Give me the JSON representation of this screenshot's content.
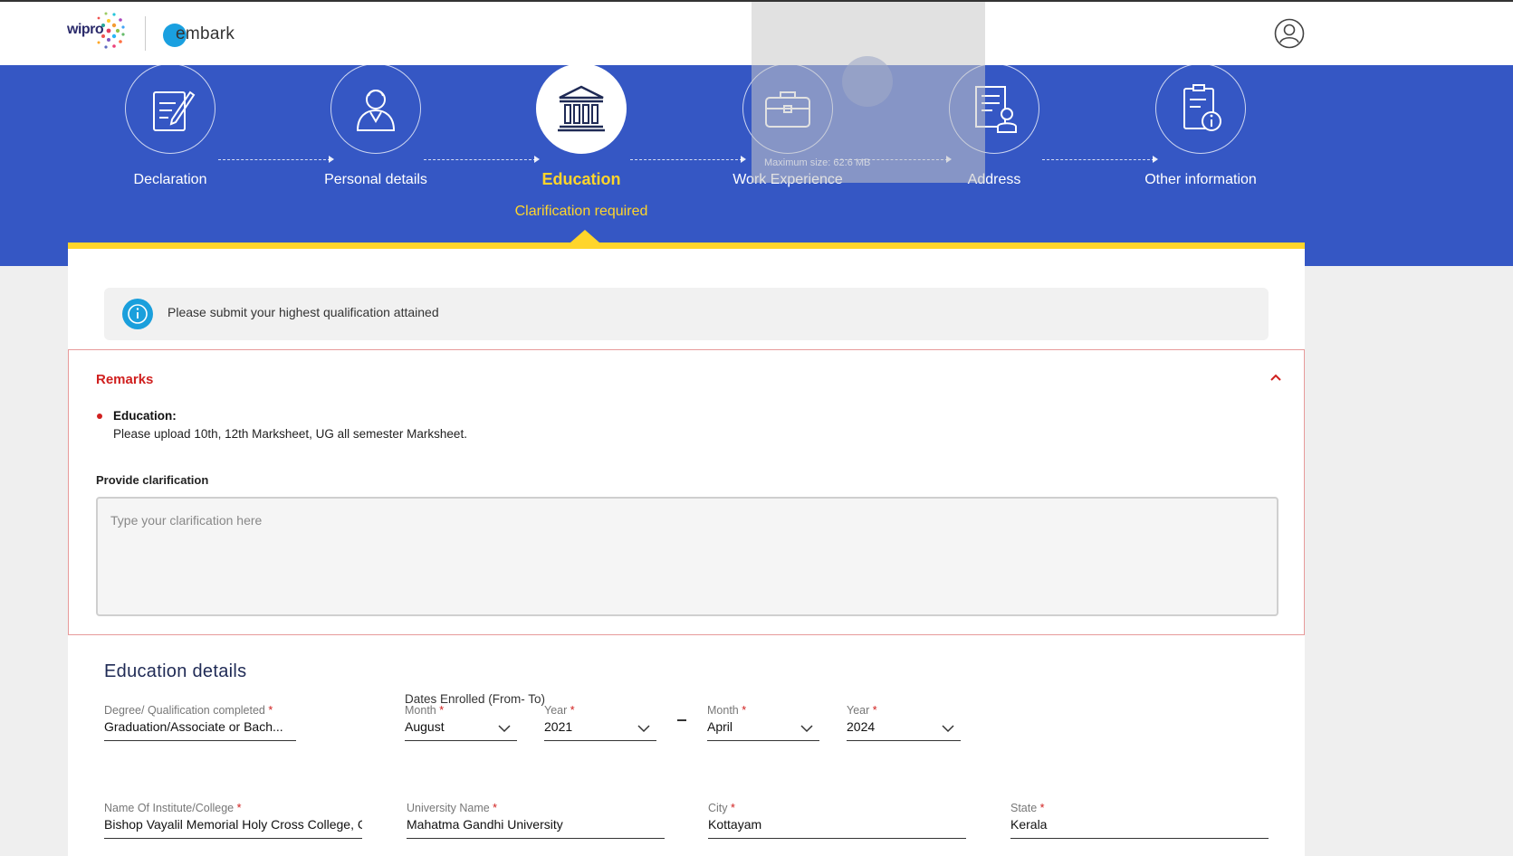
{
  "header": {
    "logo_primary": "wipro",
    "logo_secondary": "embark",
    "profile_icon": "user-circle-icon"
  },
  "overlay": {
    "text": "Maximum size: 62.6 MB"
  },
  "steps": [
    {
      "label": "Declaration",
      "icon": "document-edit-icon",
      "active": false
    },
    {
      "label": "Personal details",
      "icon": "person-icon",
      "active": false
    },
    {
      "label": "Education",
      "icon": "institution-icon",
      "active": true,
      "status": "Clarification required"
    },
    {
      "label": "Work Experience",
      "icon": "briefcase-icon",
      "active": false
    },
    {
      "label": "Address",
      "icon": "address-document-icon",
      "active": false
    },
    {
      "label": "Other information",
      "icon": "info-document-icon",
      "active": false
    }
  ],
  "info": {
    "text": "Please submit your highest qualification attained"
  },
  "remarks": {
    "title": "Remarks",
    "item_label": "Education:",
    "item_text": "Please upload 10th, 12th Marksheet, UG all semester Marksheet.",
    "clarification_label": "Provide clarification",
    "clarification_placeholder": "Type your clarification here",
    "clarification_value": ""
  },
  "education": {
    "section_title": "Education details",
    "dates_title": "Dates Enrolled (From- To)",
    "degree": {
      "label": "Degree/ Qualification completed",
      "value": "Graduation/Associate or Bach..."
    },
    "from_month": {
      "label": "Month",
      "value": "August"
    },
    "from_year": {
      "label": "Year",
      "value": "2021"
    },
    "to_month": {
      "label": "Month",
      "value": "April"
    },
    "to_year": {
      "label": "Year",
      "value": "2024"
    },
    "institute": {
      "label": "Name Of Institute/College",
      "value": "Bishop Vayalil Memorial Holy Cross College, C"
    },
    "university": {
      "label": "University Name",
      "value": "Mahatma Gandhi University"
    },
    "city": {
      "label": "City",
      "value": "Kottayam"
    },
    "state": {
      "label": "State",
      "value": "Kerala"
    }
  },
  "colors": {
    "banner": "#3557c4",
    "accent_yellow": "#ffd52b",
    "alert_red": "#d0201f",
    "info_blue": "#1a9fdc"
  }
}
